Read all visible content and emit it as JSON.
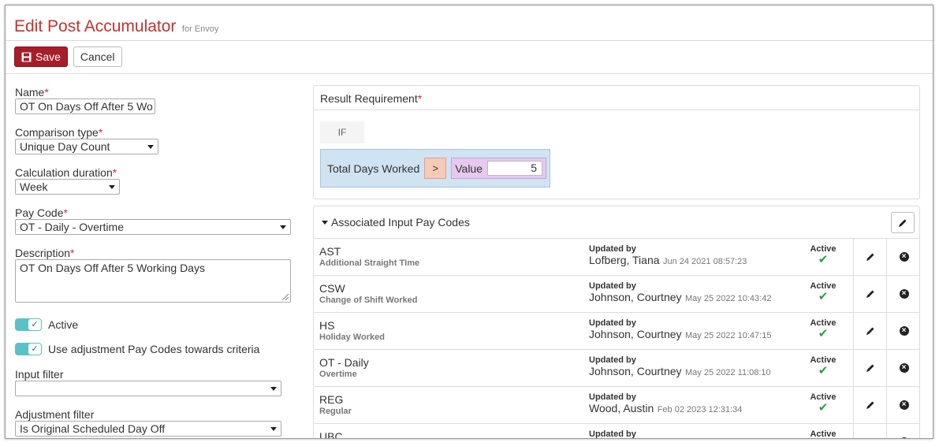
{
  "header": {
    "title": "Edit Post Accumulator",
    "subtitle": "for Envoy"
  },
  "toolbar": {
    "save_label": "Save",
    "cancel_label": "Cancel"
  },
  "form": {
    "name": {
      "label": "Name",
      "value": "OT On Days Off After 5 Wo"
    },
    "comparison_type": {
      "label": "Comparison type",
      "value": "Unique Day Count"
    },
    "calculation_duration": {
      "label": "Calculation duration",
      "value": "Week"
    },
    "pay_code": {
      "label": "Pay Code",
      "value": "OT - Daily - Overtime"
    },
    "description": {
      "label": "Description",
      "value": "OT On Days Off After 5 Working Days"
    },
    "active_toggle": {
      "label": "Active",
      "checked": true
    },
    "adjustment_toggle": {
      "label": "Use adjustment Pay Codes towards criteria",
      "checked": true
    },
    "input_filter": {
      "label": "Input filter",
      "value": ""
    },
    "adjustment_filter": {
      "label": "Adjustment filter",
      "value": "Is Original Scheduled Day Off"
    }
  },
  "result": {
    "title": "Result Requirement",
    "if_label": "IF",
    "metric": "Total Days Worked",
    "operator": ">",
    "value_label": "Value",
    "value": "5"
  },
  "assoc": {
    "title": "Associated Input Pay Codes",
    "updated_label": "Updated by",
    "active_label": "Active",
    "rows": [
      {
        "code": "AST",
        "desc": "Additional Straight TIme",
        "name": "Lofberg, Tiana",
        "date": "Jun 24 2021 08:57:23"
      },
      {
        "code": "CSW",
        "desc": "Change of Shift Worked",
        "name": "Johnson, Courtney",
        "date": "May 25 2022 10:43:42"
      },
      {
        "code": "HS",
        "desc": "Holiday Worked",
        "name": "Johnson, Courtney",
        "date": "May 25 2022 10:47:15"
      },
      {
        "code": "OT - Daily",
        "desc": "Overtime",
        "name": "Johnson, Courtney",
        "date": "May 25 2022 11:08:10"
      },
      {
        "code": "REG",
        "desc": "Regular",
        "name": "Wood, Austin",
        "date": "Feb 02 2023 12:31:34"
      },
      {
        "code": "UBC",
        "desc": "",
        "name": "",
        "date": ""
      }
    ]
  },
  "colors": {
    "accent": "#c9302c",
    "save": "#a71d2a",
    "toggle": "#5bc0c7",
    "condition": "#cfe3f2",
    "operator": "#f7c9b7",
    "value": "#e5c9ee",
    "check": "#2e9d45"
  }
}
